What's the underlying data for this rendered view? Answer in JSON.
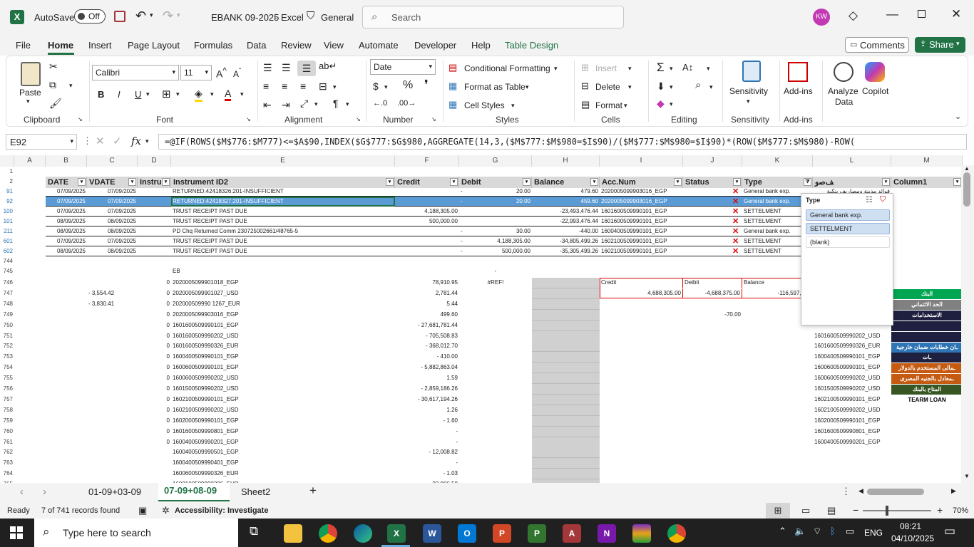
{
  "titlebar": {
    "autosave_label": "AutoSave",
    "autosave_state": "Off",
    "filename": "EBANK 09-2025",
    "app": "Excel",
    "sensitivity": "General",
    "search_placeholder": "Search",
    "user_initials": "KW"
  },
  "menu": {
    "items": [
      "File",
      "Home",
      "Insert",
      "Page Layout",
      "Formulas",
      "Data",
      "Review",
      "View",
      "Automate",
      "Developer",
      "Help",
      "Table Design"
    ],
    "comments": "Comments",
    "share": "Share"
  },
  "ribbon": {
    "paste": "Paste",
    "clipboard": "Clipboard",
    "font_name": "Calibri",
    "font_size": "11",
    "font": "Font",
    "alignment": "Alignment",
    "number_format": "Date",
    "number": "Number",
    "conditional_formatting": "Conditional Formatting",
    "format_as_table": "Format as Table",
    "cell_styles": "Cell Styles",
    "styles": "Styles",
    "insert": "Insert",
    "delete": "Delete",
    "format": "Format",
    "cells": "Cells",
    "editing": "Editing",
    "sensitivity": "Sensitivity",
    "addins": "Add-ins",
    "analyze_data_1": "Analyze",
    "analyze_data_2": "Data",
    "copilot": "Copilot"
  },
  "formula_bar": {
    "name_box": "E92",
    "fx": "fx",
    "formula": "=@IF(ROWS($M$776:$M777)<=$A$90,INDEX($G$777:$G$980,AGGREGATE(14,3,($M$777:$M$980=$I$90)/($M$777:$M$980=$I$90)*(ROW($M$777:$M$980)-ROW("
  },
  "columns": [
    "A",
    "B",
    "C",
    "D",
    "E",
    "F",
    "G",
    "H",
    "I",
    "J",
    "K",
    "L",
    "M"
  ],
  "table_headers": [
    "DATE",
    "VDATE",
    "Instru",
    "Instrument ID2",
    "Credit",
    "Debit",
    "Balance",
    "Acc.Num",
    "Status",
    "Type",
    "ﻒﺻﻭ",
    "Column1"
  ],
  "table_rows": [
    {
      "rn": "91",
      "date": "07/09/2025",
      "vdate": "07/09/2025",
      "inst": "RETURNED:42418326:201-INSUFFICIENT",
      "credit": "",
      "debit": "20.00",
      "debit_dash": "-",
      "balance": "479.60",
      "acc": "2020005099903016_EGP",
      "type": "General bank exp.",
      "desc": "فوائد مدينة ومصاريف بنكية",
      "sel": false
    },
    {
      "rn": "92",
      "date": "07/09/2025",
      "vdate": "07/09/2025",
      "inst": "RETURNED:42418327:201-INSUFFICIENT",
      "credit": "",
      "debit": "20.00",
      "debit_dash": "-",
      "balance": "459.60",
      "acc": "2020005099903016_EGP",
      "type": "General bank exp.",
      "desc": "",
      "sel": true
    },
    {
      "rn": "100",
      "date": "07/09/2025",
      "vdate": "07/09/2025",
      "inst": "TRUST RECEIPT PAST DUE",
      "credit": "4,188,305.00",
      "debit": "",
      "debit_dash": "",
      "balance": "-23,493,476.44",
      "acc": "1601600509990101_EGP",
      "type": "SETTELMENT",
      "desc": "",
      "sel": false
    },
    {
      "rn": "101",
      "date": "08/09/2025",
      "vdate": "08/09/2025",
      "inst": "TRUST RECEIPT PAST DUE",
      "credit": "500,000.00",
      "debit": "",
      "debit_dash": "",
      "balance": "-22,993,476.44",
      "acc": "1601600509990101_EGP",
      "type": "SETTELMENT",
      "desc": "",
      "sel": false
    },
    {
      "rn": "211",
      "date": "08/09/2025",
      "vdate": "08/09/2025",
      "inst": "PD Chq Returned Comm 230725002661/48765-5",
      "credit": "",
      "debit": "30.00",
      "debit_dash": "-",
      "balance": "-440.00",
      "acc": "1600400509990101_EGP",
      "type": "General bank exp.",
      "desc": "",
      "sel": false
    },
    {
      "rn": "601",
      "date": "07/09/2025",
      "vdate": "07/09/2025",
      "inst": "TRUST RECEIPT PAST DUE",
      "credit": "",
      "debit": "4,188,305.00",
      "debit_dash": "-",
      "balance": "-34,805,499.26",
      "acc": "1602100509990101_EGP",
      "type": "SETTELMENT",
      "desc": "",
      "sel": false
    },
    {
      "rn": "602",
      "date": "08/09/2025",
      "vdate": "08/09/2025",
      "inst": "TRUST RECEIPT PAST DUE",
      "credit": "",
      "debit": "500,000.00",
      "debit_dash": "-",
      "balance": "-35,305,499.26",
      "acc": "1602100509990101_EGP",
      "type": "SETTELMENT",
      "desc": "",
      "sel": false
    }
  ],
  "lower_rows": [
    {
      "rn": "744",
      "c": "",
      "d": "",
      "e": "",
      "f": "",
      "g": "",
      "l": ""
    },
    {
      "rn": "745",
      "c": "",
      "d": "",
      "e": "EB",
      "f": "",
      "g": "-",
      "l": ""
    },
    {
      "rn": "746",
      "c": "",
      "d": "0",
      "e": "2020005099901018_EGP",
      "f": "78,910.95",
      "g": "#REF!",
      "l": ""
    },
    {
      "rn": "747",
      "c": "-   3,554.42",
      "d": "0",
      "e": "2020005099901027_USD",
      "f": "2,781.44",
      "g": "",
      "l": ""
    },
    {
      "rn": "748",
      "c": "-   3,830.41",
      "d": "0",
      "e": "202000509990 1267_EUR",
      "f": "5.44",
      "g": "",
      "l": ""
    },
    {
      "rn": "749",
      "c": "",
      "d": "0",
      "e": "2020005099903016_EGP",
      "f": "499.60",
      "g": "",
      "l": ""
    },
    {
      "rn": "750",
      "c": "",
      "d": "0",
      "e": "1601600509990101_EGP",
      "f": "- 27,681,781.44",
      "g": "",
      "l": ""
    },
    {
      "rn": "751",
      "c": "",
      "d": "0",
      "e": "1601600509990202_USD",
      "f": "-    705,508.83",
      "g": "",
      "l": "1601600509990202_USD"
    },
    {
      "rn": "752",
      "c": "",
      "d": "0",
      "e": "1601600509990326_EUR",
      "f": "-    368,012.70",
      "g": "",
      "l": "1601600509990326_EUR"
    },
    {
      "rn": "753",
      "c": "",
      "d": "0",
      "e": "1600400509990101_EGP",
      "f": "-         410.00",
      "g": "",
      "l": "1600400509990101_EGP"
    },
    {
      "rn": "754",
      "c": "",
      "d": "0",
      "e": "1600600509990101_EGP",
      "f": "-  5,882,863.04",
      "g": "",
      "l": "1600600509990101_EGP"
    },
    {
      "rn": "755",
      "c": "",
      "d": "0",
      "e": "1600600509990202_USD",
      "f": "1.59",
      "g": "",
      "l": "1600600509990202_USD"
    },
    {
      "rn": "756",
      "c": "",
      "d": "0",
      "e": "1601500509990202_USD",
      "f": "-  2,859,186.26",
      "g": "",
      "l": "1601500509990202_USD"
    },
    {
      "rn": "757",
      "c": "",
      "d": "0",
      "e": "1602100509990101_EGP",
      "f": "- 30,617,194.26",
      "g": "",
      "l": "1602100509990101_EGP"
    },
    {
      "rn": "758",
      "c": "",
      "d": "0",
      "e": "1602100509990202_USD",
      "f": "1.26",
      "g": "",
      "l": "1602100509990202_USD"
    },
    {
      "rn": "759",
      "c": "",
      "d": "0",
      "e": "1602000509990101_EGP",
      "f": "-          1.60",
      "g": "",
      "l": "1602000509990101_EGP"
    },
    {
      "rn": "760",
      "c": "",
      "d": "0",
      "e": "1601600509990801_EGP",
      "f": "-",
      "g": "",
      "l": "1601600509990801_EGP"
    },
    {
      "rn": "761",
      "c": "",
      "d": "0",
      "e": "1600400509990201_EGP",
      "f": "-",
      "g": "",
      "l": "1600400509990201_EGP"
    },
    {
      "rn": "762",
      "c": "",
      "d": "",
      "e": "1600400509990501_EGP",
      "f": "-     12,008.82",
      "g": "",
      "l": ""
    },
    {
      "rn": "763",
      "c": "",
      "d": "",
      "e": "1600400509990401_EGP",
      "f": "-",
      "g": "",
      "l": ""
    },
    {
      "rn": "764",
      "c": "",
      "d": "",
      "e": "1600600509990326_EUR",
      "f": "-          1.03",
      "g": "",
      "l": ""
    },
    {
      "rn": "765",
      "c": "",
      "d": "",
      "e": "1602100509990326_EUR",
      "f": "-     23,986.58",
      "g": "",
      "l": ""
    }
  ],
  "summary": {
    "credit_label": "Credit",
    "debit_label": "Deibit",
    "balance_label": "Balance",
    "credit_value": "4,688,305.00",
    "debit_value": "-4,688,375.00",
    "balance_value": "-116,597,452",
    "r748_value": "-70.00"
  },
  "m_labels": [
    {
      "t": "البنك",
      "bg": "#00a651",
      "fg": "#ffffff"
    },
    {
      "t": "الحد الائتماني",
      "bg": "#808080",
      "fg": "#ffffff"
    },
    {
      "t": "الاستخدامات",
      "bg": "#1f1f3f",
      "fg": "#ffffff"
    },
    {
      "t": "",
      "bg": "#1f1f3f",
      "fg": "#ffffff"
    },
    {
      "t": "",
      "bg": "#1f1f3f",
      "fg": "#ffffff"
    },
    {
      "t": "ـان خطابات ضمان خارجية",
      "bg": "#2e75b6",
      "fg": "#ffffff"
    },
    {
      "t": "ـات",
      "bg": "#1f1f3f",
      "fg": "#ffffff"
    },
    {
      "t": "ـمالى المستخدم بالدولار",
      "bg": "#c55a11",
      "fg": "#ffffff"
    },
    {
      "t": "ـمعادل بالجنيه المصرى",
      "bg": "#c55a11",
      "fg": "#ffffff"
    },
    {
      "t": "المتاح بالبنك",
      "bg": "#375623",
      "fg": "#ffffff"
    },
    {
      "t": "TEARM LOAN",
      "bg": "#ffffff",
      "fg": "#000000"
    }
  ],
  "filter_popup": {
    "title": "Type",
    "items": [
      "General bank exp.",
      "SETTELMENT",
      "(blank)"
    ]
  },
  "sheets": [
    "01-09+03-09",
    "07-09+08-09",
    "Sheet2"
  ],
  "status": {
    "ready": "Ready",
    "records": "7 of 741 records found",
    "accessibility": "Accessibility: Investigate",
    "zoom": "70%"
  },
  "taskbar": {
    "search": "Type here to search",
    "lang": "ENG",
    "time": "08:21",
    "date": "04/10/2025"
  },
  "colors": {
    "excel_green": "#217346",
    "selection": "#5b9bd5",
    "header_gray": "#d9d9d9",
    "error_red": "#e00000"
  }
}
